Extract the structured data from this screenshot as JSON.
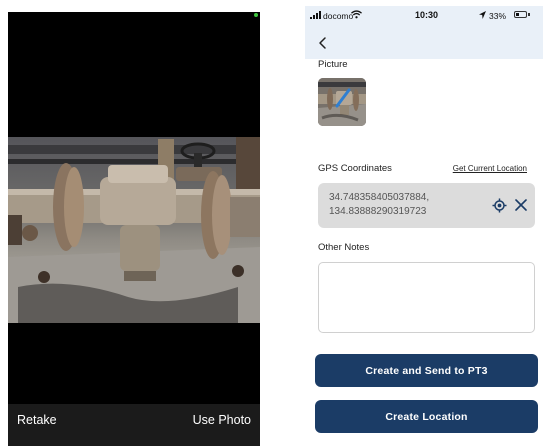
{
  "camera": {
    "retake_label": "Retake",
    "use_photo_label": "Use Photo",
    "photo_icon": "photo-pipe-valve"
  },
  "status_bar": {
    "carrier": "docomo",
    "time": "10:30",
    "battery_percent_label": "33%",
    "battery_level": 0.33
  },
  "nav": {
    "back_icon": "chevron-left-icon"
  },
  "form": {
    "picture_label": "Picture",
    "gps_label": "GPS Coordinates",
    "get_location_label": "Get Current Location",
    "gps_value_line1": "34.748358405037884,",
    "gps_value_line2": "134.83888290319723",
    "notes_label": "Other Notes",
    "notes_value": "",
    "send_button_label": "Create and Send to PT3",
    "create_button_label": "Create Location"
  },
  "colors": {
    "primary": "#1b3c66",
    "header_bg": "#e9f0f8",
    "input_bg": "#dcdcdc"
  }
}
